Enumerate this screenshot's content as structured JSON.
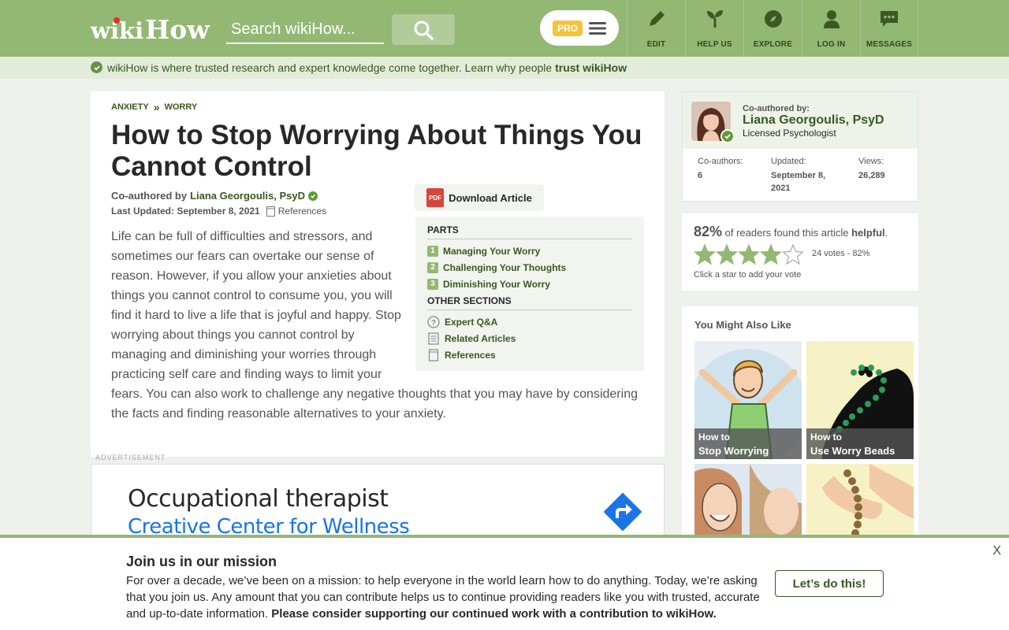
{
  "header": {
    "logo_wiki": "wiki",
    "logo_how": "How",
    "search_placeholder": "Search wikiHow...",
    "pro_label": "PRO",
    "nav": [
      {
        "label": "EDIT",
        "icon": "pencil-icon"
      },
      {
        "label": "HELP US",
        "icon": "sprout-icon"
      },
      {
        "label": "EXPLORE",
        "icon": "compass-icon"
      },
      {
        "label": "LOG IN",
        "icon": "user-icon"
      },
      {
        "label": "MESSAGES",
        "icon": "chat-icon"
      }
    ]
  },
  "trustbar": {
    "text": "wikiHow is where trusted research and expert knowledge come together. Learn why people ",
    "link": "trust wikiHow"
  },
  "article": {
    "breadcrumb": [
      "ANXIETY",
      "WORRY"
    ],
    "breadcrumb_sep": "»",
    "title": "How to Stop Worrying About Things You Cannot Control",
    "coauthored_prefix": "Co-authored by",
    "author": "Liana Georgoulis, PsyD",
    "updated_label": "Last Updated: September 8, 2021",
    "references_label": "References",
    "intro": "Life can be full of difficulties and stressors, and sometimes our fears can overtake our sense of reason. However, if you allow your anxieties about things you cannot control to consume you, you will find it hard to live a life that is joyful and happy. Stop worrying about things you cannot control by managing and diminishing your worries through practicing self care and finding ways to limit your fears. You can also work to challenge any negative thoughts that you may have by considering the facts and finding reasonable alternatives to your anxiety.",
    "download_label": "Download Article",
    "pdf_label": "PDF",
    "toc": {
      "parts_heading": "PARTS",
      "parts": [
        {
          "num": "1",
          "label": "Managing Your Worry"
        },
        {
          "num": "2",
          "label": "Challenging Your Thoughts"
        },
        {
          "num": "3",
          "label": "Diminishing Your Worry"
        }
      ],
      "other_heading": "OTHER SECTIONS",
      "other": [
        {
          "label": "Expert Q&A",
          "icon": "question-icon"
        },
        {
          "label": "Related Articles",
          "icon": "document-icon"
        },
        {
          "label": "References",
          "icon": "bookmark-icon"
        }
      ]
    }
  },
  "ad": {
    "label": "ADVERTISEMENT",
    "title": "Occupational therapist",
    "subtitle": "Creative Center for Wellness"
  },
  "sidebar": {
    "coauthored_by": "Co-authored by:",
    "author_name": "Liana Georgoulis, PsyD",
    "author_role": "Licensed Psychologist",
    "stats": [
      {
        "label": "Co-authors:",
        "value": "6"
      },
      {
        "label": "Updated:",
        "value": "September 8, 2021"
      },
      {
        "label": "Views:",
        "value": "26,289"
      }
    ],
    "rating": {
      "percent": "82%",
      "text": " of readers found this article ",
      "helpful": "helpful",
      "period": ".",
      "stars_filled": 4,
      "stars_total": 5,
      "votes": "24 votes - 82%",
      "hint": "Click a star to add your vote"
    },
    "related_heading": "You Might Also Like",
    "related": [
      {
        "prefix": "How to",
        "title": "Stop Worrying"
      },
      {
        "prefix": "How to",
        "title": "Use Worry Beads"
      },
      {
        "prefix": "",
        "title": ""
      },
      {
        "prefix": "",
        "title": ""
      }
    ]
  },
  "banner": {
    "close": "X",
    "title": "Join us in our mission",
    "text": "For over a decade, we’ve been on a mission: to help everyone in the world learn how to do anything. Today, we’re asking that you join us. Any amount that you can contribute helps us to continue providing readers like you with trusted, accurate and up-to-date information. ",
    "text_bold": "Please consider supporting our continued work with a contribution to wikiHow.",
    "button": "Let’s do this!"
  },
  "colors": {
    "brand_green": "#93b874",
    "link_green": "#38591f",
    "ad_blue": "#1a73e8",
    "star_filled": "#93b874"
  }
}
